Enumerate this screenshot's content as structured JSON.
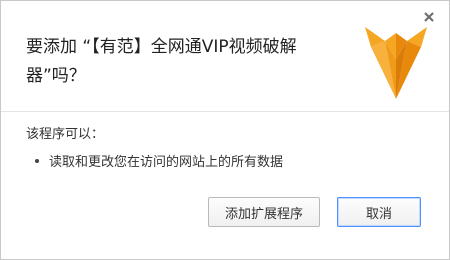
{
  "dialog": {
    "title": "要添加 “【有范】全网通VIP视频破解器”吗？",
    "permissions_heading": "该程序可以：",
    "permissions": [
      "读取和更改您在访问的网站上的所有数据"
    ],
    "add_button_label": "添加扩展程序",
    "cancel_button_label": "取消",
    "close_icon": "close-icon",
    "logo_icon": "fox-logo-icon"
  },
  "colors": {
    "logo_light": "#f5a623",
    "logo_dark": "#e8890c",
    "focus_border": "#4d90fe"
  }
}
